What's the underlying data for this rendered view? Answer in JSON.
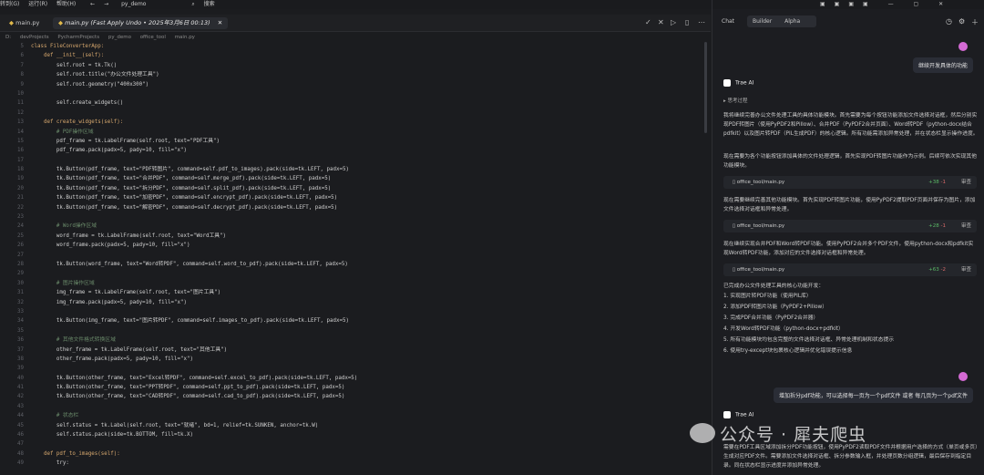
{
  "menubar": {
    "items": [
      "转到(G)",
      "运行(R)",
      "帮助(H)"
    ],
    "project": "py_demo",
    "search": "搜索"
  },
  "tabs": [
    {
      "label": "main.py",
      "active": false
    },
    {
      "label": "main.py (Fast Apply Undo • 2025年3月6日 00:13)",
      "active": true
    }
  ],
  "breadcrumb": [
    "D:",
    "devProjects",
    "PycharmProjects",
    "py_demo",
    "office_tool",
    "main.py"
  ],
  "code": {
    "line_numbers": [
      "5",
      "6",
      "7",
      "8",
      "9",
      "10",
      "11",
      "12",
      "13",
      "14",
      "15",
      "16",
      "17",
      "18",
      "19",
      "20",
      "21",
      "22",
      "23",
      "24",
      "25",
      "26",
      "27",
      "28",
      "29",
      "30",
      "31",
      "32",
      "33",
      "34",
      "35",
      "36",
      "37",
      "38",
      "39",
      "40",
      "41",
      "42",
      "43",
      "44",
      "45",
      "46",
      "47",
      "48",
      "49"
    ],
    "lines": [
      "class FileConverterApp:",
      "    def __init__(self):",
      "        self.root = tk.Tk()",
      "        self.root.title(\"办公文件处理工具\")",
      "        self.root.geometry(\"400x300\")",
      "",
      "        self.create_widgets()",
      "",
      "    def create_widgets(self):",
      "        # PDF操作区域",
      "        pdf_frame = tk.LabelFrame(self.root, text=\"PDF工具\")",
      "        pdf_frame.pack(padx=5, pady=10, fill=\"x\")",
      "",
      "        tk.Button(pdf_frame, text=\"PDF转图片\", command=self.pdf_to_images).pack(side=tk.LEFT, padx=5)",
      "        tk.Button(pdf_frame, text=\"合并PDF\", command=self.merge_pdf).pack(side=tk.LEFT, padx=5)",
      "        tk.Button(pdf_frame, text=\"拆分PDF\", command=self.split_pdf).pack(side=tk.LEFT, padx=5)",
      "        tk.Button(pdf_frame, text=\"加密PDF\", command=self.encrypt_pdf).pack(side=tk.LEFT, padx=5)",
      "        tk.Button(pdf_frame, text=\"解密PDF\", command=self.decrypt_pdf).pack(side=tk.LEFT, padx=5)",
      "",
      "        # Word操作区域",
      "        word_frame = tk.LabelFrame(self.root, text=\"Word工具\")",
      "        word_frame.pack(padx=5, pady=10, fill=\"x\")",
      "",
      "        tk.Button(word_frame, text=\"Word转PDF\", command=self.word_to_pdf).pack(side=tk.LEFT, padx=5)",
      "",
      "        # 图片操作区域",
      "        img_frame = tk.LabelFrame(self.root, text=\"图片工具\")",
      "        img_frame.pack(padx=5, pady=10, fill=\"x\")",
      "",
      "        tk.Button(img_frame, text=\"图片转PDF\", command=self.images_to_pdf).pack(side=tk.LEFT, padx=5)",
      "",
      "        # 其他文件格式转换区域",
      "        other_frame = tk.LabelFrame(self.root, text=\"其他工具\")",
      "        other_frame.pack(padx=5, pady=10, fill=\"x\")",
      "",
      "        tk.Button(other_frame, text=\"Excel转PDF\", command=self.excel_to_pdf).pack(side=tk.LEFT, padx=5)",
      "        tk.Button(other_frame, text=\"PPT转PDF\", command=self.ppt_to_pdf).pack(side=tk.LEFT, padx=5)",
      "        tk.Button(other_frame, text=\"CAD转PDF\", command=self.cad_to_pdf).pack(side=tk.LEFT, padx=5)",
      "",
      "        # 状态栏",
      "        self.status = tk.Label(self.root, text=\"就绪\", bd=1, relief=tk.SUNKEN, anchor=tk.W)",
      "        self.status.pack(side=tk.BOTTOM, fill=tk.X)",
      "",
      "    def pdf_to_images(self):",
      "        try:"
    ]
  },
  "panel": {
    "tab_chat": "Chat",
    "tab_builder": "Builder",
    "tab_alpha": "Alpha",
    "user_msg_1": "继续开发具体的功能",
    "assistant_name": "Trae AI",
    "thinking": "思考过程",
    "para1": "我将继续完善办公文件处理工具的具体功能模块。首先需要为每个按钮功能添加文件选择对话框，然后分别实现PDF转图片（使用PyPDF2和Pillow）、合并PDF（PyPDF2合并页面）、Word转PDF（python-docx结合pdfkit）以及图片转PDF（PIL生成PDF）的核心逻辑。所有功能需添加异常处理，并在状态栏显示操作进度。",
    "para2": "现在需要为各个功能按钮添加具体的文件处理逻辑，首先实现PDF转图片功能作为示例。后续可依次实现其他功能模块。",
    "file1": {
      "name": "office_tool/main.py",
      "add": "+38",
      "del": "-1",
      "review": "审查"
    },
    "para3": "现在需要继续完善其他功能模块。首先实现PDF转图片功能，使用PyPDF2提取PDF页面并保存为图片，添加文件选择对话框和异常处理。",
    "file2": {
      "name": "office_tool/main.py",
      "add": "+28",
      "del": "-1",
      "review": "审查"
    },
    "para4": "现在继续实现合并PDF和Word转PDF功能。使用PyPDF2合并多个PDF文件，使用python-docx和pdfkit实现Word转PDF功能，添加对应的文件选择对话框和异常处理。",
    "file3": {
      "name": "office_tool/main.py",
      "add": "+63",
      "del": "-2",
      "review": "审查"
    },
    "summary_intro": "已完成办公文件处理工具的核心功能开发：",
    "summary": [
      "1. 实现图片转PDF功能（使用PIL库）",
      "2. 添加PDF转图片功能（PyPDF2+Pillow）",
      "3. 完成PDF合并功能（PyPDF2合并器）",
      "4. 开发Word转PDF功能（python-docx+pdfkit）",
      "5. 所有功能模块均包含完整的文件选择对话框、异常处理机制和状态提示",
      "6. 使用try-except块包裹核心逻辑并优化错误提示信息"
    ],
    "user_msg_2": "增加拆分pdf功能，可以选择每一页为一个pdf文件 或者 每几页为一个pdf文件",
    "final_para": "需要在PDF工具区域添加拆分PDF功能按钮，使用PyPDF2读取PDF文件并根据用户选择的方式（单页或多页）生成对应PDF文件。需要添加文件选择对话框、拆分参数输入框，并处理页数分组逻辑，最后保存到指定目录。同在状态栏显示进度并添加异常处理。",
    "watermark": "公众号 · 犀夫爬虫"
  }
}
